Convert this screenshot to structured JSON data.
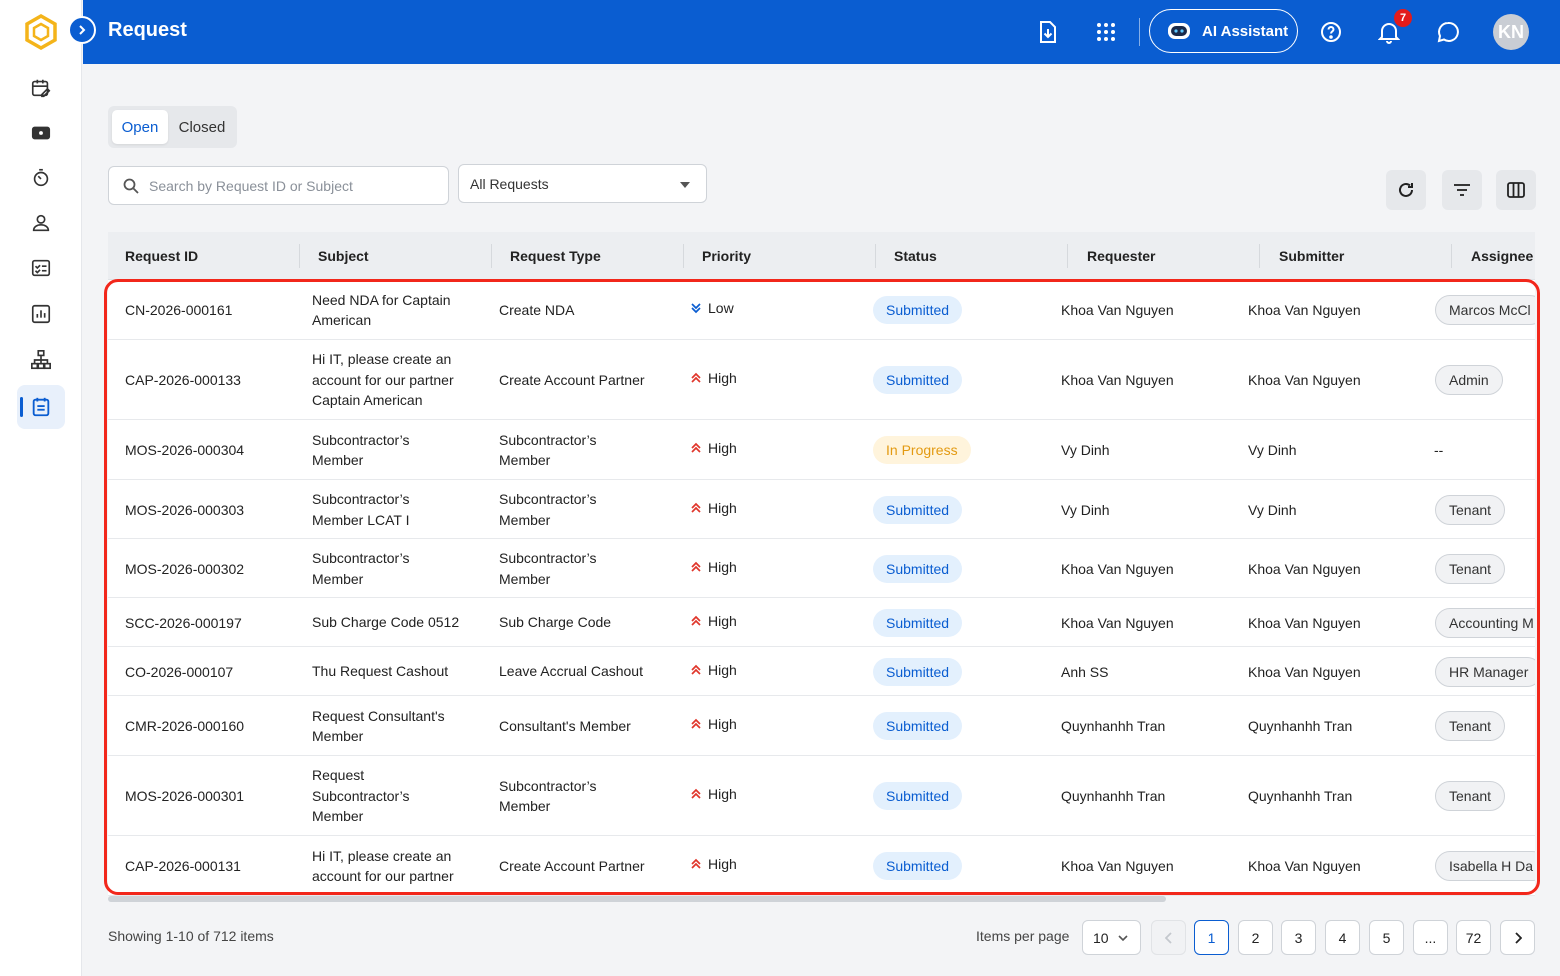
{
  "header": {
    "title": "Request",
    "ai_button_label": "AI Assistant",
    "notification_count": "7",
    "avatar_initials": "KN",
    "bg_color": "#0a5dd1"
  },
  "sidebar": {
    "items": [
      {
        "icon": "calendar-edit-icon"
      },
      {
        "icon": "money-icon"
      },
      {
        "icon": "timer-icon"
      },
      {
        "icon": "user-icon"
      },
      {
        "icon": "checklist-icon"
      },
      {
        "icon": "report-chart-icon"
      },
      {
        "icon": "org-chart-icon"
      },
      {
        "icon": "request-list-icon",
        "active": true
      }
    ]
  },
  "tabs": {
    "open": "Open",
    "closed": "Closed",
    "selected": "Open"
  },
  "search": {
    "placeholder": "Search by Request ID or Subject"
  },
  "filter_select": {
    "value": "All Requests"
  },
  "table": {
    "columns": [
      "Request ID",
      "Subject",
      "Request Type",
      "Priority",
      "Status",
      "Requester",
      "Submitter",
      "Assignee"
    ],
    "rows": [
      {
        "id": "CN-2026-000161",
        "subject": [
          "Need NDA for Captain",
          "American"
        ],
        "type": [
          "Create NDA"
        ],
        "priority": "Low",
        "status": "Submitted",
        "requester": "Khoa Van Nguyen",
        "submitter": "Khoa Van Nguyen",
        "assignee": "Marcos McCl"
      },
      {
        "id": "CAP-2026-000133",
        "subject": [
          "Hi IT, please create an",
          "account for our partner",
          "Captain American"
        ],
        "type": [
          "Create Account Partner"
        ],
        "priority": "High",
        "status": "Submitted",
        "requester": "Khoa Van Nguyen",
        "submitter": "Khoa Van Nguyen",
        "assignee": "Admin"
      },
      {
        "id": "MOS-2026-000304",
        "subject": [
          "Subcontractor’s",
          "Member"
        ],
        "type": [
          "Subcontractor’s",
          "Member"
        ],
        "priority": "High",
        "status": "In Progress",
        "requester": "Vy Dinh",
        "submitter": "Vy Dinh",
        "assignee": "--"
      },
      {
        "id": "MOS-2026-000303",
        "subject": [
          "Subcontractor’s",
          "Member LCAT I"
        ],
        "type": [
          "Subcontractor’s",
          "Member"
        ],
        "priority": "High",
        "status": "Submitted",
        "requester": "Vy Dinh",
        "submitter": "Vy Dinh",
        "assignee": "Tenant"
      },
      {
        "id": "MOS-2026-000302",
        "subject": [
          "Subcontractor’s",
          "Member"
        ],
        "type": [
          "Subcontractor’s",
          "Member"
        ],
        "priority": "High",
        "status": "Submitted",
        "requester": "Khoa Van Nguyen",
        "submitter": "Khoa Van Nguyen",
        "assignee": "Tenant"
      },
      {
        "id": "SCC-2026-000197",
        "subject": [
          "Sub Charge Code 0512"
        ],
        "type": [
          "Sub Charge Code"
        ],
        "priority": "High",
        "status": "Submitted",
        "requester": "Khoa Van Nguyen",
        "submitter": "Khoa Van Nguyen",
        "assignee": "Accounting M"
      },
      {
        "id": "CO-2026-000107",
        "subject": [
          "Thu Request Cashout"
        ],
        "type": [
          "Leave Accrual Cashout"
        ],
        "priority": "High",
        "status": "Submitted",
        "requester": "Anh SS",
        "submitter": "Khoa Van Nguyen",
        "assignee": "HR Manager"
      },
      {
        "id": "CMR-2026-000160",
        "subject": [
          "Request Consultant's",
          "Member"
        ],
        "type": [
          "Consultant's Member"
        ],
        "priority": "High",
        "status": "Submitted",
        "requester": "Quynhanhh Tran",
        "submitter": "Quynhanhh Tran",
        "assignee": "Tenant"
      },
      {
        "id": "MOS-2026-000301",
        "subject": [
          "Request",
          "Subcontractor’s",
          "Member"
        ],
        "type": [
          "Subcontractor’s",
          "Member"
        ],
        "priority": "High",
        "status": "Submitted",
        "requester": "Quynhanhh Tran",
        "submitter": "Quynhanhh Tran",
        "assignee": "Tenant"
      },
      {
        "id": "CAP-2026-000131",
        "subject": [
          "Hi IT, please create an",
          "account for our partner"
        ],
        "type": [
          "Create Account Partner"
        ],
        "priority": "High",
        "status": "Submitted",
        "requester": "Khoa Van Nguyen",
        "submitter": "Khoa Van Nguyen",
        "assignee": "Isabella H Da"
      }
    ]
  },
  "footer": {
    "showing": "Showing 1-10 of 712 items",
    "items_per_page_label": "Items per page",
    "items_per_page": "10",
    "pages": [
      "1",
      "2",
      "3",
      "4",
      "5",
      "...",
      "72"
    ],
    "current_page": "1"
  },
  "colors": {
    "accent": "#0a5dd1",
    "submitted_bg": "#e3f0fd",
    "in_progress_text": "#e39a12",
    "high_priority": "#e0362b",
    "low_priority": "#0a5dd1",
    "highlight_border": "#f2271b"
  }
}
